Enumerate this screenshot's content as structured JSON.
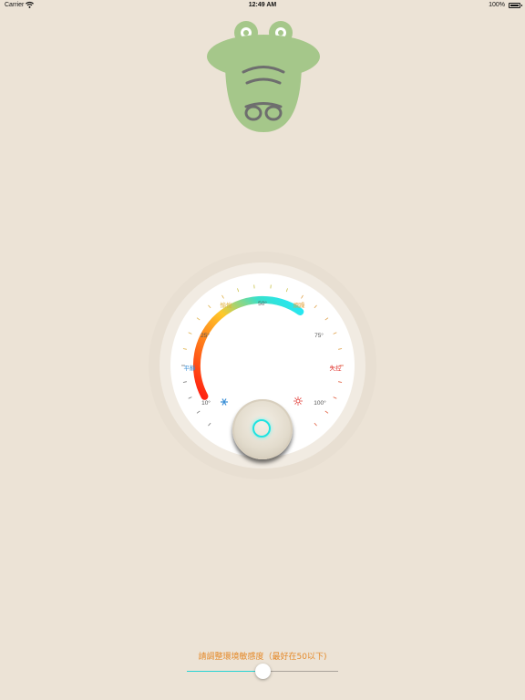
{
  "status_bar": {
    "carrier": "Carrier",
    "time": "12:49 AM",
    "battery": "100%",
    "battery_level": 1.0
  },
  "dial": {
    "labels": {
      "calm": "平靜",
      "pleasant": "愉悅",
      "fifty": "50°",
      "upset": "煩躁",
      "twentyfive": "25°",
      "seventyfive": "75°",
      "outofcontrol": "失控",
      "ten": "10°",
      "hundred": "100°"
    },
    "icons": {
      "cold": "snowflake-icon",
      "hot": "sun-icon"
    },
    "colors": {
      "gradient": [
        "#ff1a10",
        "#ff7a1a",
        "#ffc829",
        "#39e0c9",
        "#1fe9ff"
      ],
      "calm": "#3a8fd6",
      "pleasant": "#e2b13a",
      "upset": "#e2a13a",
      "outofcontrol": "#e0332d",
      "knob_ring": "#1fe3e0"
    }
  },
  "sensitivity": {
    "label": "請調整環境敏感度（最好在50以下)",
    "value": 0.5
  }
}
